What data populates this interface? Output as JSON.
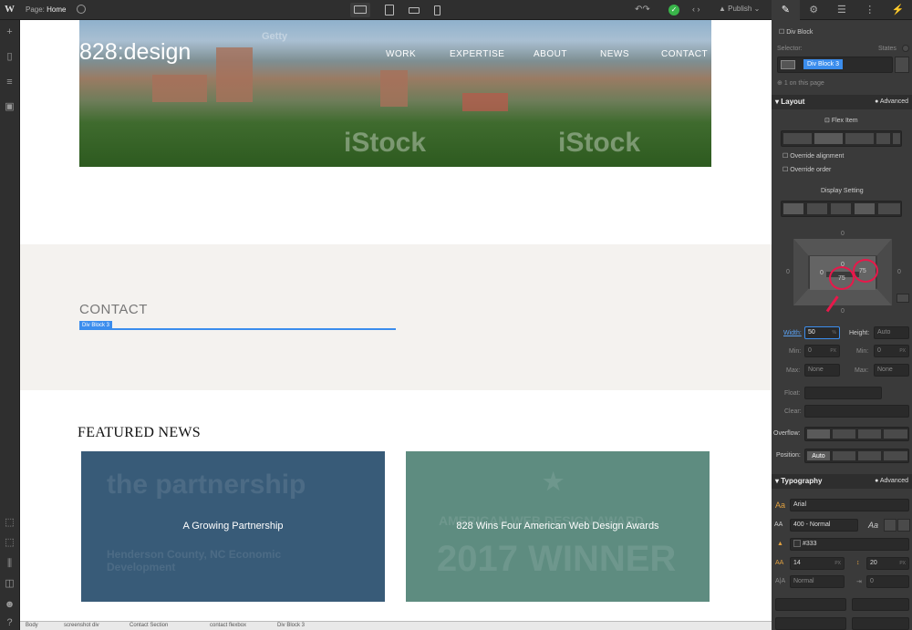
{
  "topbar": {
    "logo": "W",
    "page_label": "Page:",
    "page_name": "Home",
    "publish_label": "Publish"
  },
  "hero": {
    "logo_text": "828:design",
    "nav": [
      "WORK",
      "EXPERTISE",
      "ABOUT",
      "NEWS",
      "CONTACT"
    ],
    "watermarks": [
      "iStock",
      "iStock",
      "Getty"
    ]
  },
  "contact": {
    "heading": "CONTACT",
    "selection_badge": "Div Block 3"
  },
  "news": {
    "heading": "FEATURED NEWS",
    "cards": [
      {
        "title": "A Growing Partnership",
        "bg_text": "the partnership",
        "sub": "Henderson County, NC Economic Development",
        "color": "#385b78"
      },
      {
        "title": "828 Wins Four American Web Design Awards",
        "bg_text": "AMERICAN WEB DESIGN AWARD",
        "sub": "2017 WINNER",
        "color": "#5e8c80"
      }
    ]
  },
  "breadcrumb": [
    "Body",
    "screenshot div",
    "Contact Section",
    "contact flexbox",
    "Div Block 3"
  ],
  "panel": {
    "element_name": "Div Block",
    "selector_label": "Selector:",
    "states_label": "States",
    "selector_tag": "Div Block 3",
    "on_page": "1 on this page",
    "layout": {
      "title": "Layout",
      "advanced": "Advanced",
      "flex_item": "Flex Item",
      "override_alignment": "Override alignment",
      "override_order": "Override order",
      "display_setting": "Display Setting"
    },
    "spacing": {
      "margin_top": "0",
      "margin_left": "0",
      "margin_right": "0",
      "padding_top": "0",
      "padding_left": "0",
      "padding_right": "75",
      "padding_bottom": "75",
      "margin_bottom": "0"
    },
    "size": {
      "width_label": "Width:",
      "width_value": "50",
      "width_unit": "%",
      "height_label": "Height:",
      "height_value": "Auto",
      "min_label": "Min:",
      "min_value": "0",
      "max_label": "Max:",
      "max_value": "None",
      "unit_px": "PX"
    },
    "float_label": "Float:",
    "clear_label": "Clear:",
    "overflow_label": "Overflow:",
    "position_label": "Position:",
    "position_value": "Auto",
    "typography": {
      "title": "Typography",
      "advanced": "Advanced",
      "font": "Arial",
      "weight": "400 - Normal",
      "color": "#333",
      "size": "14",
      "size_unit": "PX",
      "line_height": "20",
      "line_unit": "PX",
      "letter_spacing": "Normal",
      "indent": "0"
    }
  },
  "colors": {
    "accent": "#3b8ded",
    "annotation": "#e8184a",
    "publish_ok": "#39b54a"
  }
}
